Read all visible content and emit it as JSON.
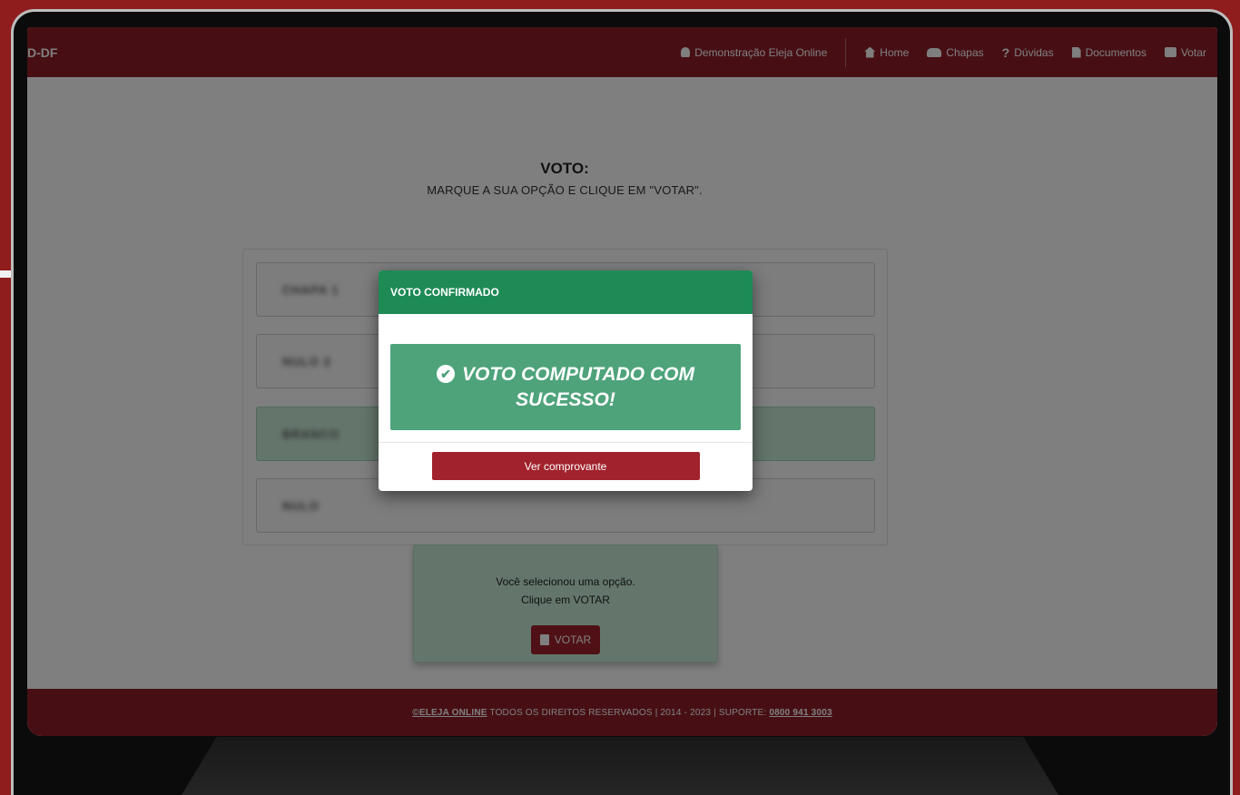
{
  "nav": {
    "brand": "D-DF",
    "user": "Demonstração Eleja Online",
    "items": [
      {
        "label": "Home",
        "icon": "home-icon"
      },
      {
        "label": "Chapas",
        "icon": "group-icon"
      },
      {
        "label": "Dúvidas",
        "icon": "question-icon"
      },
      {
        "label": "Documentos",
        "icon": "document-icon"
      },
      {
        "label": "Votar",
        "icon": "print-icon"
      }
    ]
  },
  "vote": {
    "title": "VOTO:",
    "instruction": "MARQUE A SUA OPÇÃO E CLIQUE EM \"VOTAR\".",
    "options": [
      {
        "label": "CHAPA 1",
        "selected": false
      },
      {
        "label": "NULO 2",
        "selected": false
      },
      {
        "label": "BRANCO",
        "selected": true
      },
      {
        "label": "NULO",
        "selected": false
      }
    ]
  },
  "confirm": {
    "line1": "Você selecionou uma opção.",
    "line2": "Clique em VOTAR",
    "button": "VOTAR"
  },
  "footer": {
    "brand": "©ELEJA ONLINE",
    "text": " TODOS OS DIREITOS RESERVADOS | 2014 - 2023 | SUPORTE: ",
    "phone": "0800 941 3003"
  },
  "modal": {
    "title": "VOTO CONFIRMADO",
    "message": "VOTO COMPUTADO COM SUCESSO!",
    "button": "Ver comprovante"
  },
  "colors": {
    "brand_red": "#8e1f28",
    "success_green": "#1e8a55",
    "banner_green": "#4ea37b",
    "background": "#8f1d1d"
  }
}
